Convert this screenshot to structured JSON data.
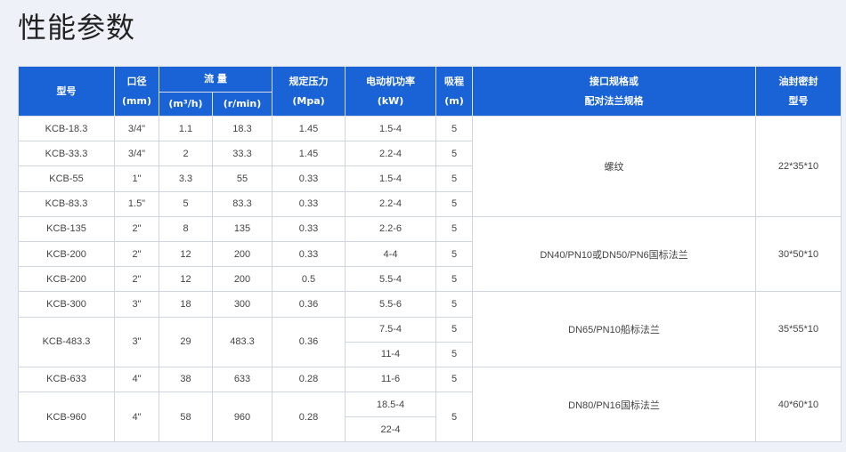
{
  "page": {
    "title": "性能参数"
  },
  "headers": {
    "model": "型号",
    "diameter": [
      "口径",
      "(mm)"
    ],
    "flow": "流 量",
    "flow_m3h": "(m³/h)",
    "flow_rmin": "(r/min)",
    "pressure": [
      "规定压力",
      "(Mpa)"
    ],
    "power": [
      "电动机功率",
      "(kW)"
    ],
    "suction": [
      "吸程",
      "(m)"
    ],
    "interface": [
      "接口规格或",
      "配对法兰规格"
    ],
    "seal": [
      "油封密封",
      "型号"
    ]
  },
  "rows": [
    {
      "model": "KCB-18.3",
      "dia": "3/4\"",
      "m3h": "1.1",
      "rmin": "18.3",
      "press": "1.45",
      "power": "1.5-4",
      "suction": "5"
    },
    {
      "model": "KCB-33.3",
      "dia": "3/4\"",
      "m3h": "2",
      "rmin": "33.3",
      "press": "1.45",
      "power": "2.2-4",
      "suction": "5"
    },
    {
      "model": "KCB-55",
      "dia": "1\"",
      "m3h": "3.3",
      "rmin": "55",
      "press": "0.33",
      "power": "1.5-4",
      "suction": "5"
    },
    {
      "model": "KCB-83.3",
      "dia": "1.5\"",
      "m3h": "5",
      "rmin": "83.3",
      "press": "0.33",
      "power": "2.2-4",
      "suction": "5"
    },
    {
      "model": "KCB-135",
      "dia": "2\"",
      "m3h": "8",
      "rmin": "135",
      "press": "0.33",
      "power": "2.2-6",
      "suction": "5"
    },
    {
      "model": "KCB-200",
      "dia": "2\"",
      "m3h": "12",
      "rmin": "200",
      "press": "0.33",
      "power": "4-4",
      "suction": "5"
    },
    {
      "model": "KCB-200",
      "dia": "2\"",
      "m3h": "12",
      "rmin": "200",
      "press": "0.5",
      "power": "5.5-4",
      "suction": "5"
    },
    {
      "model": "KCB-300",
      "dia": "3\"",
      "m3h": "18",
      "rmin": "300",
      "press": "0.36",
      "power": "5.5-6",
      "suction": "5"
    },
    {
      "model": "KCB-483.3",
      "dia": "3\"",
      "m3h": "29",
      "rmin": "483.3",
      "press": "0.36",
      "power": "7.5-4",
      "power2": "11-4",
      "suction": "5",
      "suction2": "5"
    },
    {
      "model": "KCB-633",
      "dia": "4\"",
      "m3h": "38",
      "rmin": "633",
      "press": "0.28",
      "power": "11-6",
      "suction": "5"
    },
    {
      "model": "KCB-960",
      "dia": "4\"",
      "m3h": "58",
      "rmin": "960",
      "press": "0.28",
      "power": "18.5-4",
      "power2": "22-4",
      "suction": "5"
    }
  ],
  "groups": [
    {
      "interface": "螺纹",
      "seal": "22*35*10"
    },
    {
      "interface": "DN40/PN10或DN50/PN6国标法兰",
      "seal": "30*50*10"
    },
    {
      "interface": "DN65/PN10船标法兰",
      "seal": "35*55*10"
    },
    {
      "interface": "DN80/PN16国标法兰",
      "seal": "40*60*10"
    }
  ]
}
